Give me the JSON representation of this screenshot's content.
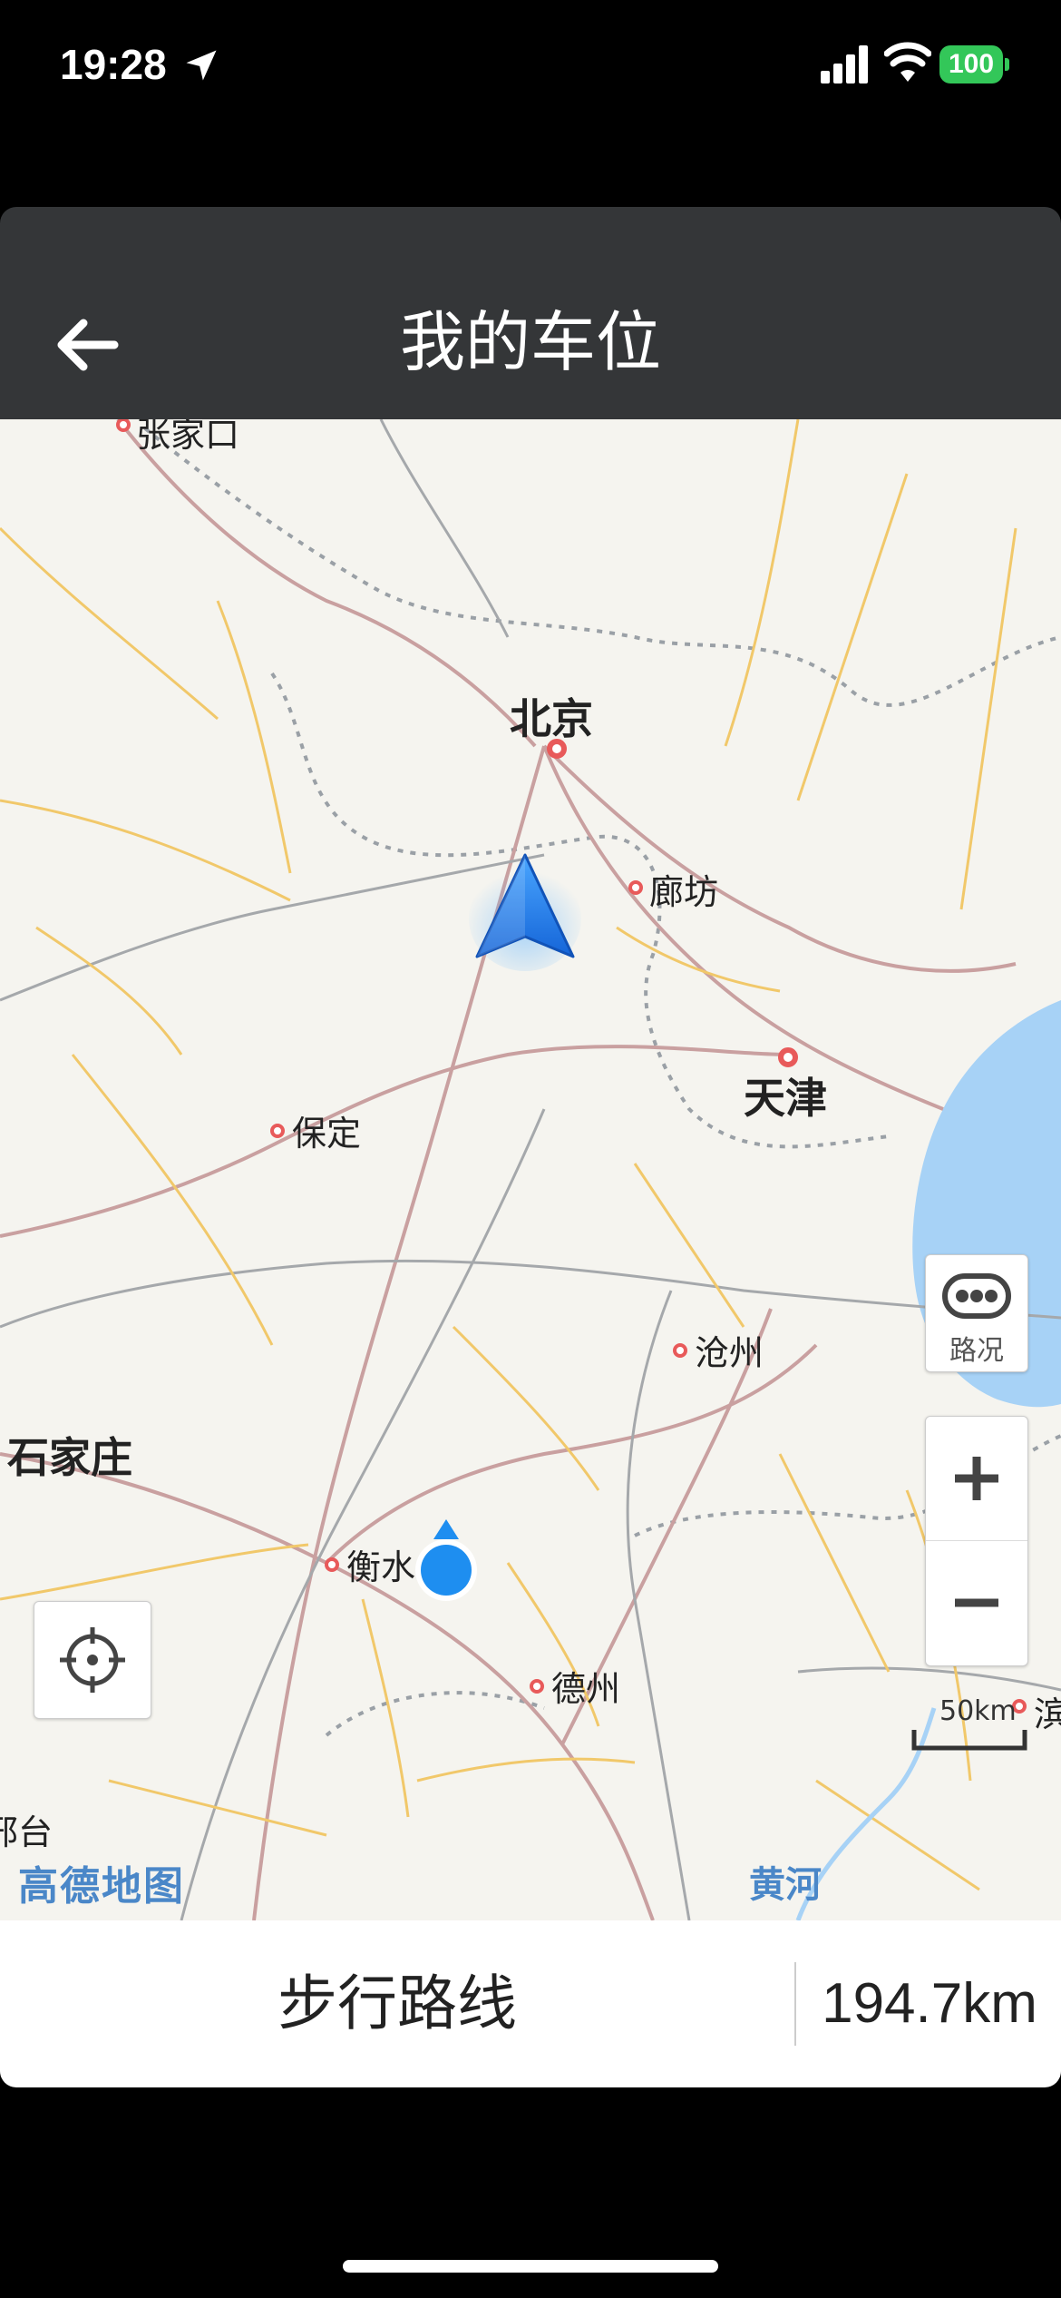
{
  "status_bar": {
    "time": "19:28",
    "battery": "100"
  },
  "header": {
    "title": "我的车位"
  },
  "map": {
    "cities": [
      {
        "name": "张家口"
      },
      {
        "name": "北京"
      },
      {
        "name": "廊坊"
      },
      {
        "name": "天津"
      },
      {
        "name": "保定"
      },
      {
        "name": "沧州"
      },
      {
        "name": "石家庄"
      },
      {
        "name": "衡水"
      },
      {
        "name": "德州"
      },
      {
        "name": "邢台"
      },
      {
        "name": "滨"
      }
    ],
    "river": "黄河",
    "brand": "高德地图",
    "traffic_label": "路况",
    "scale": "50km"
  },
  "bottom": {
    "walk_route": "步行路线",
    "distance": "194.7km"
  },
  "colors": {
    "header_bg": "#343638",
    "water": "#a7d2f6",
    "accent_blue": "#1e8ef0"
  }
}
